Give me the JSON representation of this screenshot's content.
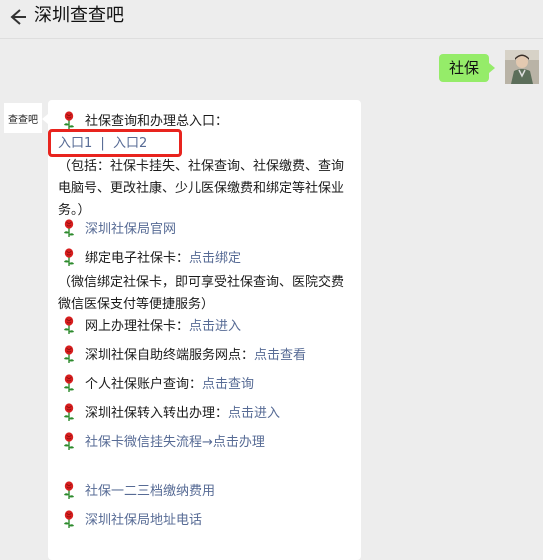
{
  "header": {
    "title": "深圳查查吧"
  },
  "user_message": {
    "text": "社保"
  },
  "bot": {
    "avatar_text": "查查吧",
    "intro_label": "社保查询和办理总入口：",
    "entry1": "入口1",
    "entry_sep": "|",
    "entry2": "入口2",
    "entry_note": "（包括：社保卡挂失、社保查询、社保缴费、查询电脑号、更改社康、少儿医保缴费和绑定等社保业务。）",
    "official_site": "深圳社保局官网",
    "bind_label": "绑定电子社保卡：",
    "bind_link": "点击绑定",
    "bind_note": "（微信绑定社保卡，即可享受社保查询、医院交费微信医保支付等便捷服务）",
    "online_label": "网上办理社保卡：",
    "online_link": "点击进入",
    "selfservice_label": "深圳社保自助终端服务网点：",
    "selfservice_link": "点击查看",
    "account_label": "个人社保账户查询：",
    "account_link": "点击查询",
    "transfer_label": "深圳社保转入转出办理：",
    "transfer_link": "点击进入",
    "wechat_loss": "社保卡微信挂失流程→点击办理",
    "tiers_fee": "社保一二三档缴纳费用",
    "address_phone": "深圳社保局地址电话"
  }
}
